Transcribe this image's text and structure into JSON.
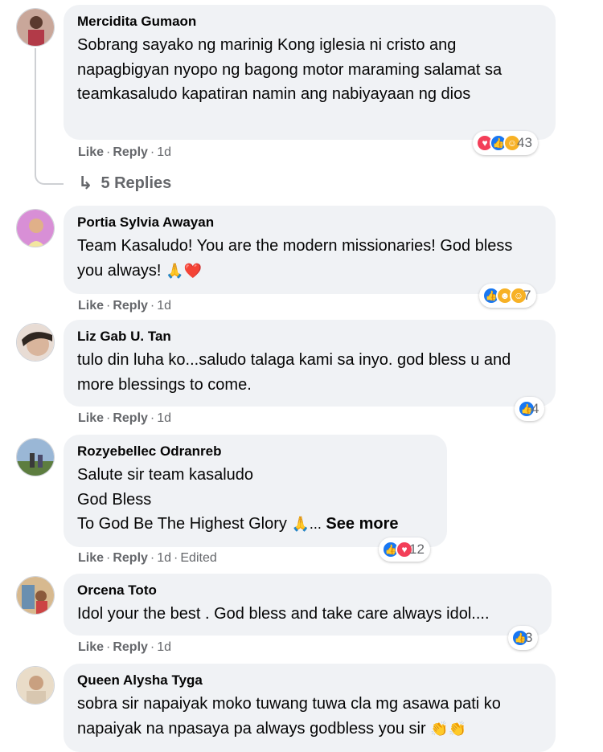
{
  "comments": [
    {
      "author": "Mercidita Gumaon",
      "text": "Sobrang sayako ng marinig Kong iglesia ni cristo ang napagbigyan nyopo ng bagong motor maraming salamat sa teamkasaludo kapatiran namin ang nabiyayaan ng dios",
      "like": "Like",
      "reply": "Reply",
      "time": "1d",
      "reactions": [
        "love",
        "like",
        "care"
      ],
      "reaction_count": "43",
      "replies_label": "5 Replies"
    },
    {
      "author": "Portia Sylvia Awayan",
      "text": "Team Kasaludo! You are the modern missionaries! God bless you always!",
      "emoji": "🙏❤️",
      "like": "Like",
      "reply": "Reply",
      "time": "1d",
      "reactions": [
        "like",
        "haha",
        "care"
      ],
      "reaction_count": "7"
    },
    {
      "author": "Liz Gab U. Tan",
      "text": "tulo din luha ko...saludo talaga kami sa inyo. god bless u and more blessings to come.",
      "like": "Like",
      "reply": "Reply",
      "time": "1d",
      "reactions": [
        "like"
      ],
      "reaction_count": "4"
    },
    {
      "author": "Rozyebellec Odranreb",
      "line1": "Salute sir team kasaludo",
      "line2": "God Bless",
      "line3": "To God Be The Highest Glory",
      "emoji": "🙏...",
      "see_more": "See more",
      "like": "Like",
      "reply": "Reply",
      "time": "1d",
      "edited": "Edited",
      "reactions": [
        "like",
        "love"
      ],
      "reaction_count": "12"
    },
    {
      "author": "Orcena Toto",
      "text": "Idol your the best . God bless and take care always idol....",
      "like": "Like",
      "reply": "Reply",
      "time": "1d",
      "reactions": [
        "like"
      ],
      "reaction_count": "3"
    },
    {
      "author": "Queen Alysha Tyga",
      "text": "sobra sir napaiyak moko tuwang tuwa cla mg asawa pati ko napaiyak na npasaya pa always godbless you sir",
      "emoji": "👏👏"
    }
  ],
  "separator": "·",
  "colors": {
    "bubble": "#f0f2f5",
    "like": "#1877f2",
    "love": "#f33e58",
    "care": "#f7b125",
    "meta": "#65676b"
  }
}
